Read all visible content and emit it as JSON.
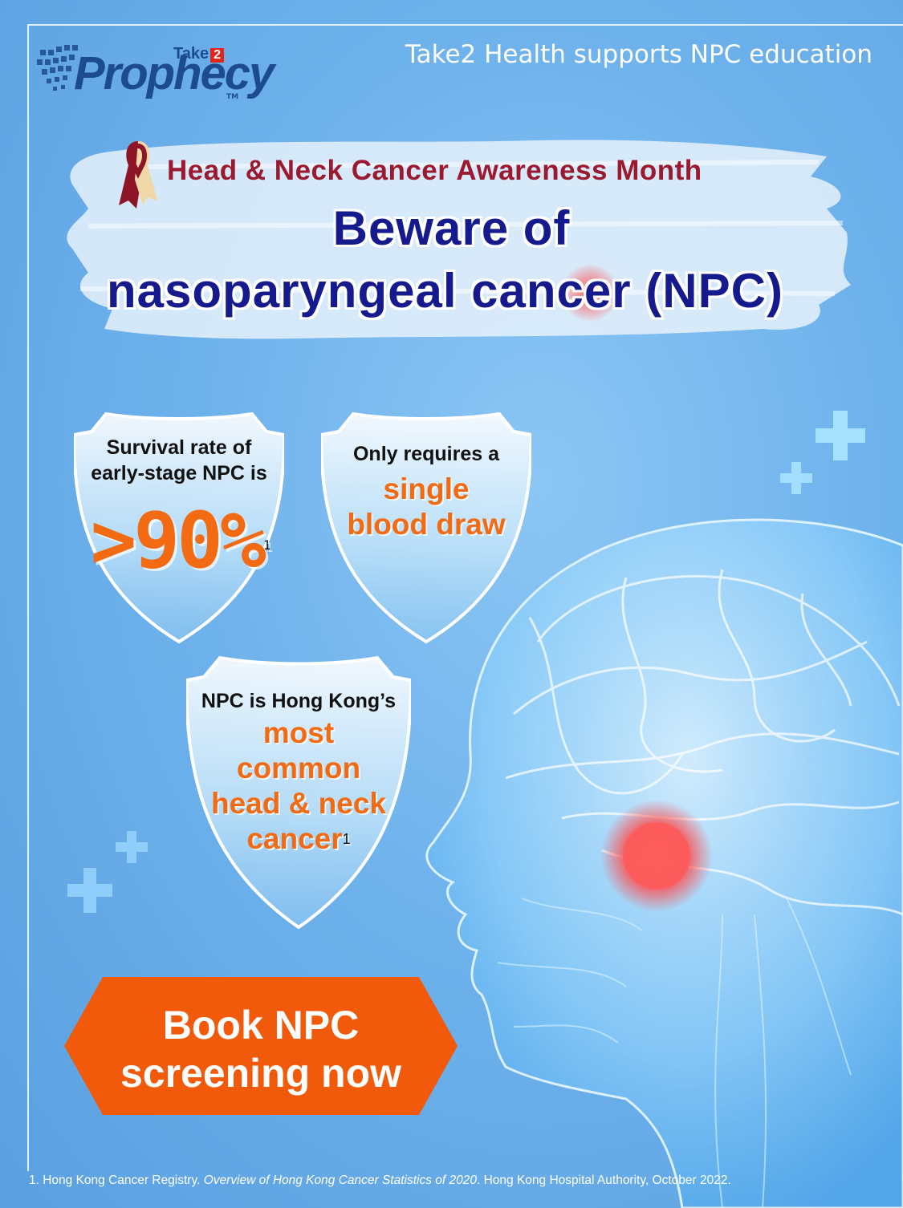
{
  "brand": {
    "logo_word": "Prophecy",
    "logo_take": "Take",
    "logo_two": "2",
    "logo_tm": "TM"
  },
  "tagline": "Take2 Health supports NPC education",
  "campaign": {
    "awareness": "Head & Neck Cancer Awareness Month",
    "headline_line1": "Beware of",
    "headline_line2": "nasoparyngeal cancer (NPC)"
  },
  "shields": {
    "survival": {
      "line1": "Survival rate of",
      "line2": "early-stage NPC is",
      "value": ">90%",
      "ref": "1"
    },
    "blood": {
      "line1": "Only requires a",
      "highlight1": "single",
      "highlight2": "blood draw"
    },
    "common": {
      "line1": "NPC is Hong Kong’s",
      "highlight1": "most",
      "highlight2": "common",
      "highlight3": "head & neck",
      "highlight4": "cancer",
      "ref": "1"
    }
  },
  "cta": {
    "line1": "Book NPC",
    "line2": "screening now"
  },
  "footnote": {
    "prefix": "1. Hong Kong Cancer Registry. ",
    "title": "Overview of Hong Kong Cancer Statistics of 2020",
    "suffix": ". Hong Kong Hospital Authority, October 2022."
  },
  "colors": {
    "background": "#6aace8",
    "headline": "#151b8c",
    "awareness": "#9b1a2f",
    "highlight": "#f26a12",
    "cta": "#f05a0a"
  },
  "icons": [
    "awareness-ribbon-icon",
    "plus-icon",
    "head-scan-illustration"
  ]
}
